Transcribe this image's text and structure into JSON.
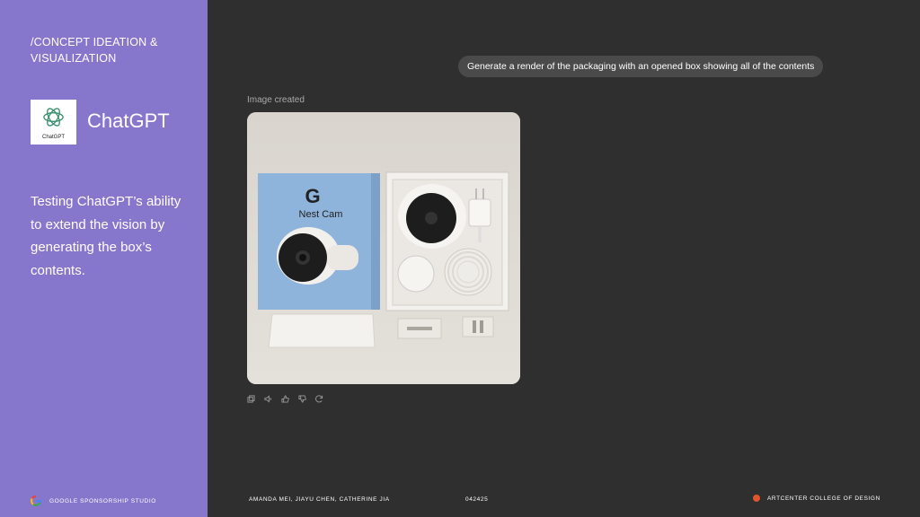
{
  "sidebar": {
    "section_title": "/CONCEPT IDEATION & VISUALIZATION",
    "logo_caption": "ChatGPT",
    "brand_name": "ChatGPT",
    "description": "Testing ChatGPT’s ability to extend the vision by generating the box’s contents.",
    "footer_label": "GOOGLE SPONSORSHIP STUDIO"
  },
  "chat": {
    "prompt": "Generate a render of the packaging with an opened box showing all of the contents",
    "image_label": "Image created",
    "render": {
      "box_logo": "G",
      "box_product": "Nest Cam"
    },
    "actions": [
      "copy-icon",
      "speaker-icon",
      "thumbs-up-icon",
      "thumbs-down-icon",
      "regenerate-icon"
    ]
  },
  "footer": {
    "authors": "AMANDA MEI, JIAYU CHEN, CATHERINE JIA",
    "date": "042425",
    "school": "ARTCENTER COLLEGE OF DESIGN"
  },
  "colors": {
    "sidebar_bg": "#8676cc",
    "main_bg": "#2f2f2f",
    "pill_bg": "#4a4a4a",
    "accent_dot": "#e0542e"
  }
}
